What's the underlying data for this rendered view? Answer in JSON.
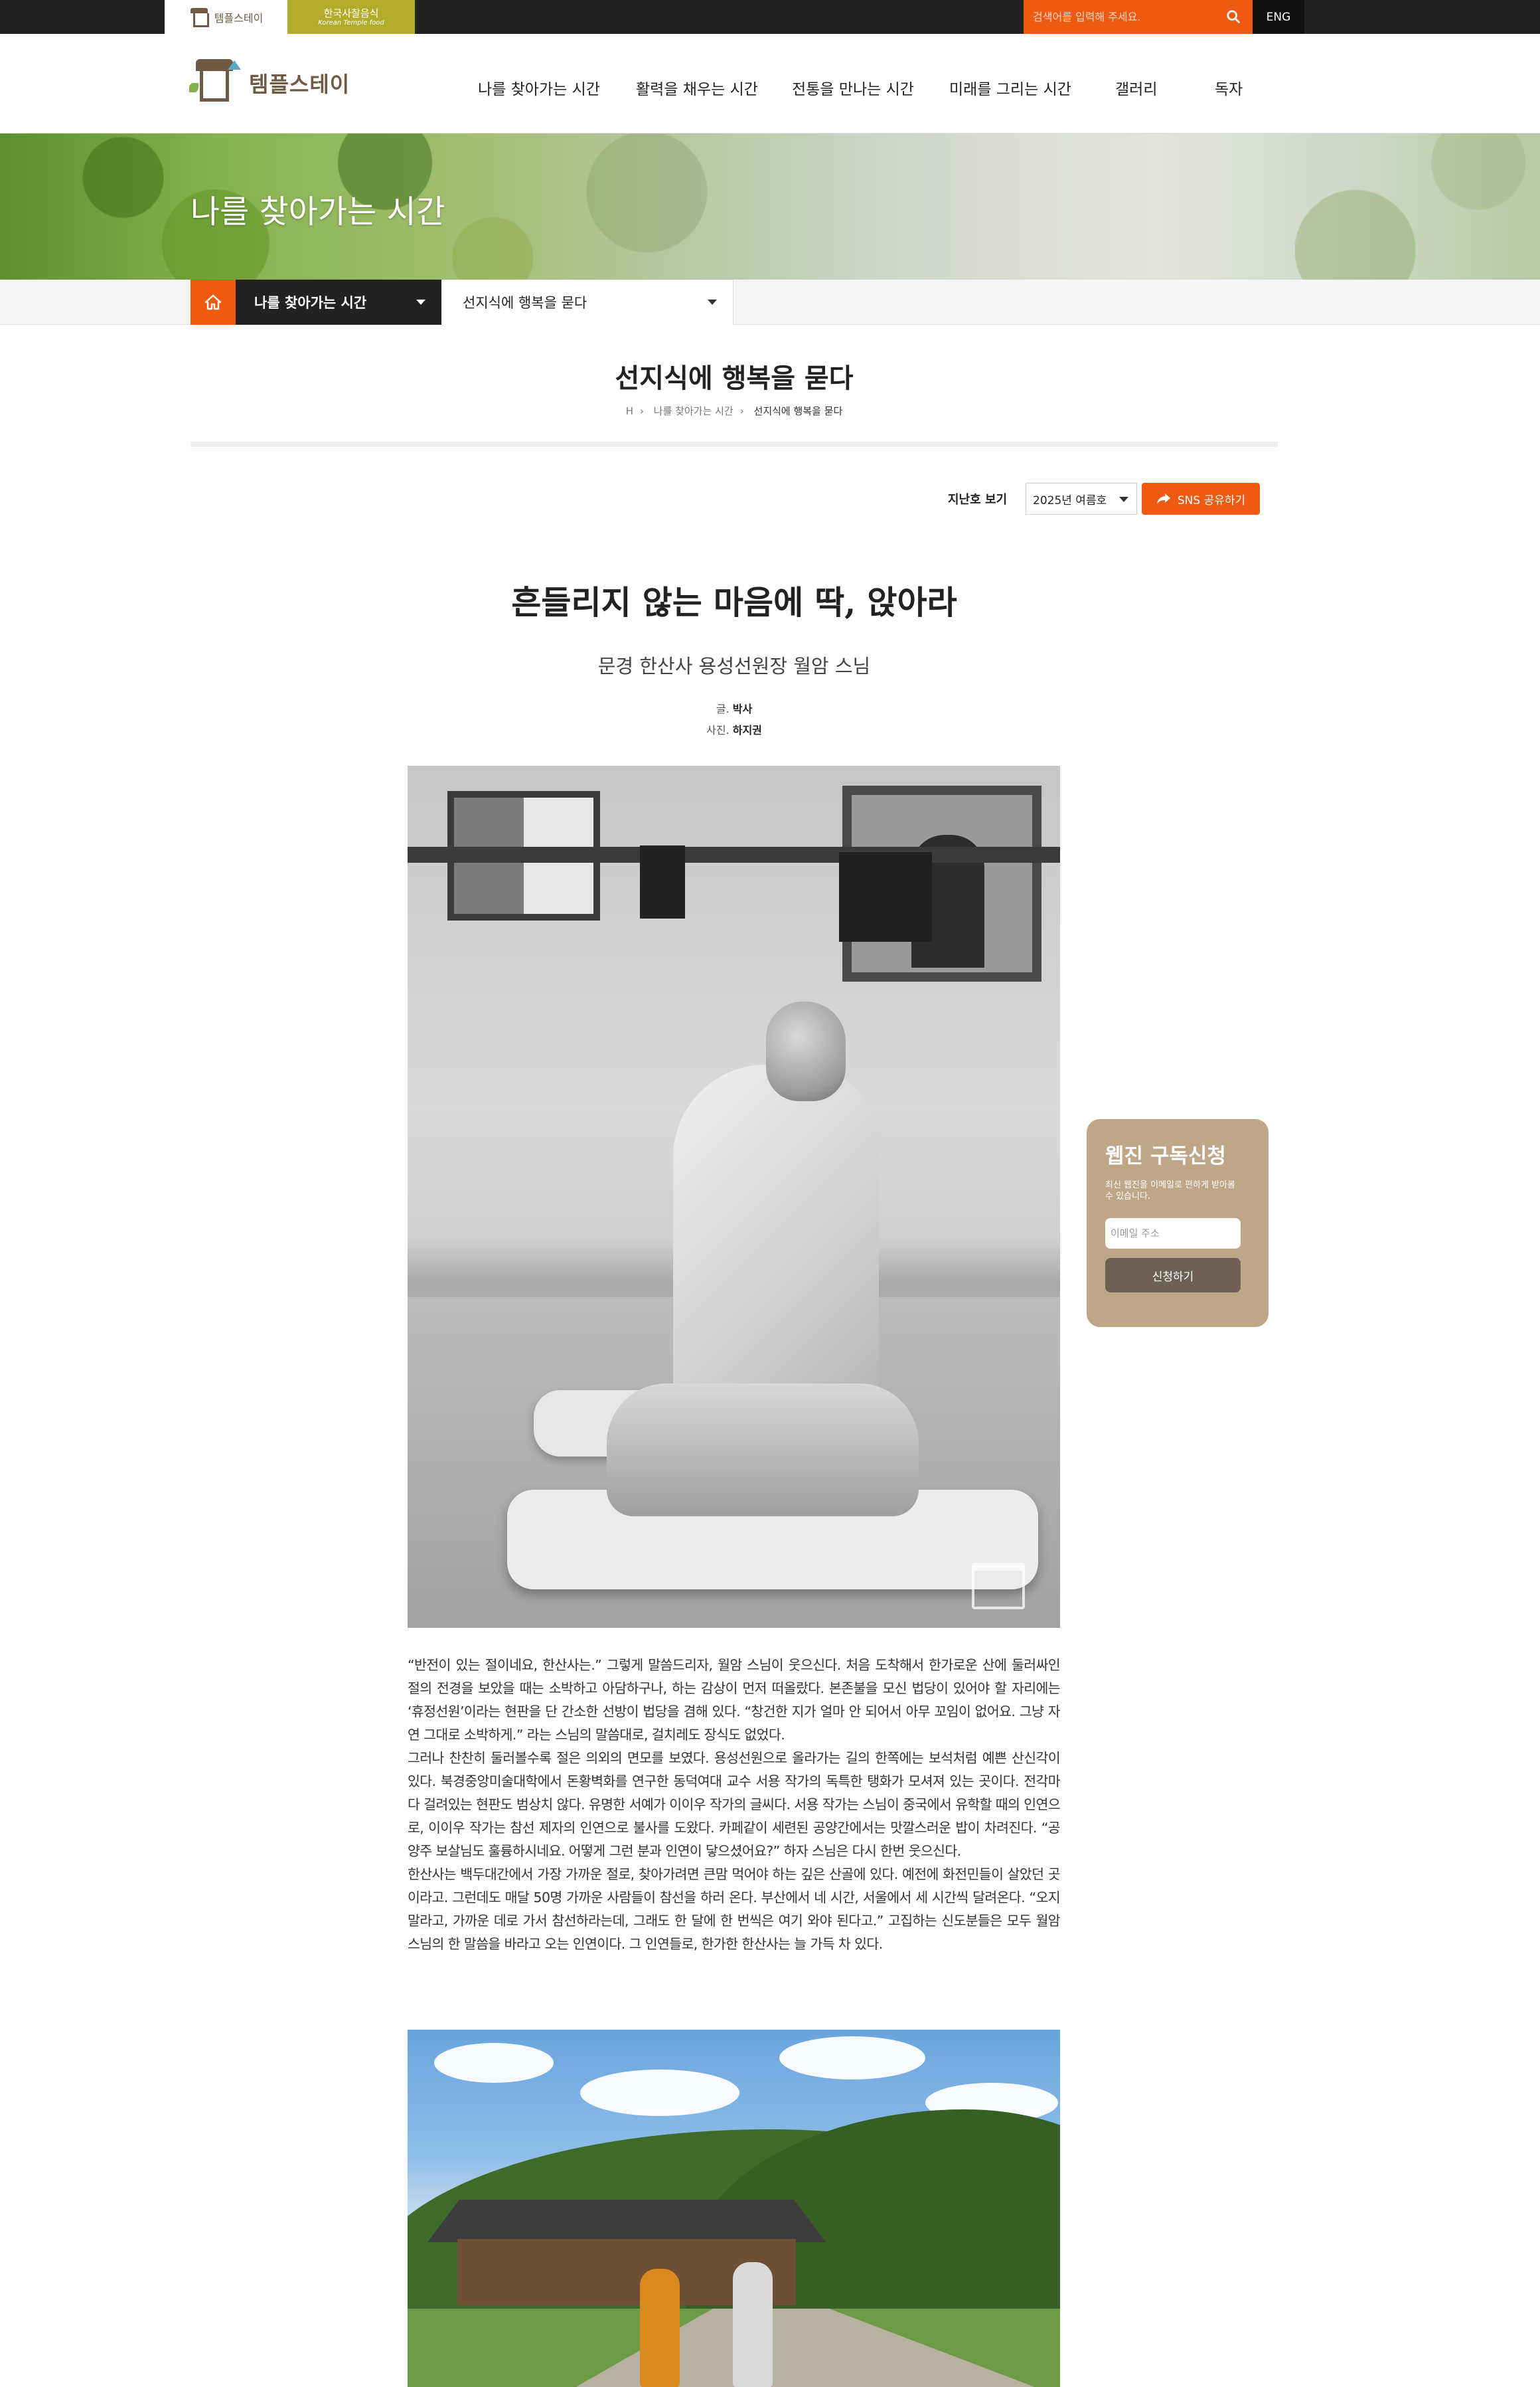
{
  "topbar": {
    "logo_tab_1": "템플스테이",
    "logo_tab_2_ko": "한국사찰음식",
    "logo_tab_2_en": "Korean Temple food",
    "search_placeholder": "검색어를 입력해 주세요.",
    "lang_label": "ENG",
    "search_color": "#ee5a12"
  },
  "header": {
    "logo_text": "템플스테이",
    "nav": [
      {
        "label": "나를 찾아가는 시간"
      },
      {
        "label": "활력을 채우는 시간"
      },
      {
        "label": "전통을 만나는 시간"
      },
      {
        "label": "미래를 그리는 시간"
      },
      {
        "label": "갤러리"
      },
      {
        "label": "독자"
      }
    ]
  },
  "banner": {
    "title": "나를 찾아가는 시간"
  },
  "location": {
    "home_icon": "home-icon",
    "depth1": "나를 찾아가는 시간",
    "depth2": "선지식에 행복을 묻다"
  },
  "page": {
    "title": "선지식에 행복을 묻다",
    "breadcrumb": [
      "H",
      "나를 찾아가는 시간",
      "선지식에 행복을 묻다"
    ]
  },
  "issue": {
    "label": "지난호 보기",
    "selected": "2025년 여름호",
    "sns_label": "SNS 공유하기"
  },
  "article": {
    "title": "흔들리지 않는 마음에 딱, 앉아라",
    "subtitle": "문경 한산사 용성선원장 월암 스님",
    "writer_label": "글.",
    "writer": "박사",
    "photo_label": "사진.",
    "photographer": "하지권",
    "paragraphs": [
      "“반전이 있는 절이네요, 한산사는.” 그렇게 말씀드리자, 월암 스님이 웃으신다. 처음 도착해서 한가로운 산에 둘러싸인 절의 전경을 보았을 때는 소박하고 아담하구나, 하는 감상이 먼저 떠올랐다. 본존불을 모신 법당이 있어야 할 자리에는 ‘휴정선원’이라는 현판을 단 간소한 선방이 법당을 겸해 있다. “창건한 지가 얼마 안 되어서 아무 꼬임이 없어요. 그냥 자연 그대로 소박하게.” 라는 스님의 말씀대로, 걸치레도 장식도 없었다.",
      "그러나 찬찬히 둘러볼수록 절은 의외의 면모를 보였다. 용성선원으로 올라가는 길의 한쪽에는 보석처럼 예쁜 산신각이 있다. 북경중앙미술대학에서 돈황벽화를 연구한 동덕여대 교수 서용 작가의 독특한 탱화가 모셔져 있는 곳이다. 전각마다 걸려있는 현판도 범상치 않다. 유명한 서예가 이이우 작가의 글씨다. 서용 작가는 스님이 중국에서 유학할 때의 인연으로, 이이우 작가는 참선 제자의 인연으로 불사를 도왔다. 카페같이 세련된 공양간에서는 맛깔스러운 밥이 차려진다. “공양주 보살님도 훌륭하시네요. 어떻게 그런 분과 인연이 닿으셨어요?” 하자 스님은 다시 한번 웃으신다.",
      "한산사는 백두대간에서 가장 가까운 절로, 찾아가려면 큰맘 먹어야 하는 깊은 산골에 있다. 예전에 화전민들이 살았던 곳이라고. 그런데도 매달 50명 가까운 사람들이 참선을 하러 온다. 부산에서 네 시간, 서울에서 세 시간씩 달려온다. “오지 말라고, 가까운 데로 가서 참선하라는데, 그래도 한 달에 한 번씩은 여기 와야 된다고.” 고집하는 신도분들은 모두 월암 스님의 한 말씀을 바라고 오는 인연이다. 그 인연들로, 한가한 한산사는 늘 가득 차 있다."
    ]
  },
  "subscribe": {
    "title": "웹진 구독신청",
    "desc": "최신 웹진을 이메일로 편하게 받아볼 수 있습니다.",
    "email_placeholder": "이메일 주소",
    "button": "신청하기",
    "bg_color": "#bea686"
  }
}
